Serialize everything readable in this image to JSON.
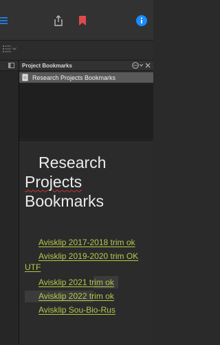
{
  "toolbar": {
    "left_icon": "sidebar-list-icon",
    "share_icon": "share-icon",
    "bookmark_icon": "bookmark-icon",
    "info_icon": "info-icon",
    "accent": "#1a8cff",
    "bookmark_color": "#e0494b"
  },
  "subtoolbar": {
    "icon": "list-view-icon"
  },
  "panel": {
    "header": "Project Bookmarks",
    "item": "Research Projects Bookmarks"
  },
  "document": {
    "title_line1": "Research",
    "title_line2": "Projects",
    "title_line3": "Bookmarks",
    "links": [
      "Avisklip 2017-2018 trim ok",
      "Avisklip 2019-2020 trim OK",
      "UTF",
      "Avisklip 2021 trim ok",
      "Avisklip 2022 trim ok",
      "Avisklip Sou-Bio-Rus"
    ],
    "link_color": "#b7c84a"
  }
}
